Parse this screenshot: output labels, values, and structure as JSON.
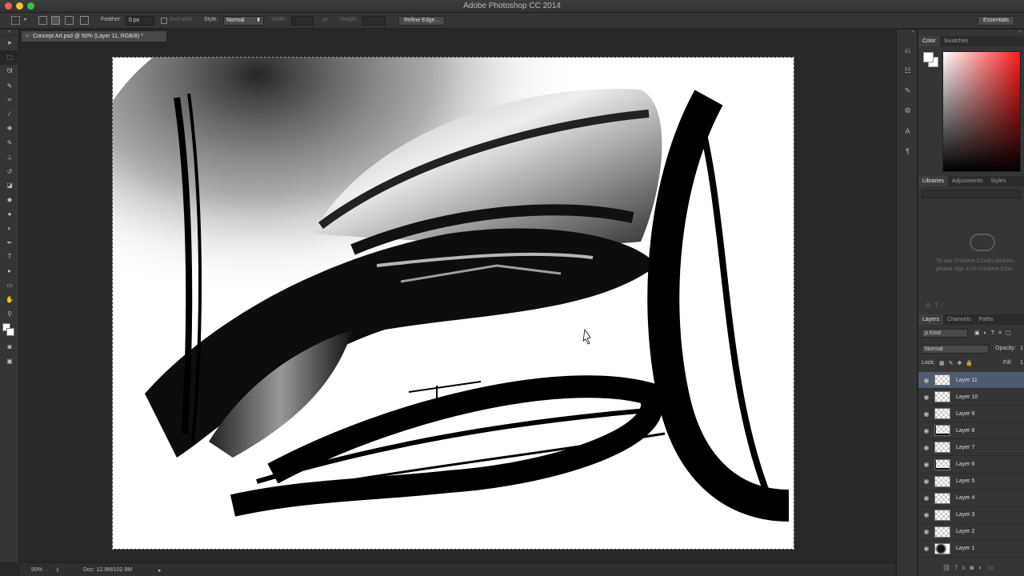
{
  "app": {
    "title": "Adobe Photoshop CC 2014"
  },
  "options_bar": {
    "feather_label": "Feather:",
    "feather_value": "0 px",
    "antialias_label": "Anti-alias",
    "style_label": "Style:",
    "style_value": "Normal",
    "width_label": "Width:",
    "height_label": "Height:",
    "refine_edge_label": "Refine Edge...",
    "workspace_label": "Essentials"
  },
  "document": {
    "tab_title": "Concept Art.psd @ 50% (Layer 11, RGB/8) *",
    "close_glyph": "×"
  },
  "status_bar": {
    "zoom": "50%",
    "doc_info": "Doc: 12.9M/102.9M"
  },
  "color_panel": {
    "tabs": [
      "Color",
      "Swatches"
    ],
    "foreground": "#ffffff",
    "background": "#ffffff",
    "hue_accent": "#ff1a1a"
  },
  "libraries_panel": {
    "tabs": [
      "Libraries",
      "Adjustments",
      "Styles"
    ],
    "message_line1": "To use Creative Cloud Libraries",
    "message_line2": "please sign in to Creative Clou"
  },
  "layers_panel": {
    "tabs": [
      "Layers",
      "Channels",
      "Paths"
    ],
    "kind_filter": "ρ Kind",
    "blend_mode": "Normal",
    "opacity_label": "Opacity:",
    "opacity_value": "1",
    "lock_label": "Lock:",
    "fill_label": "Fill:",
    "fill_value": "1",
    "selected_accent": "#4e5a72",
    "layers": [
      {
        "name": "Layer 11",
        "selected": true,
        "thumb": "transparent"
      },
      {
        "name": "Layer 10",
        "selected": false,
        "thumb": "transparent"
      },
      {
        "name": "Layer 9",
        "selected": false,
        "thumb": "transparent"
      },
      {
        "name": "Layer 8",
        "selected": false,
        "thumb": "strokes"
      },
      {
        "name": "Layer 7",
        "selected": false,
        "thumb": "transparent"
      },
      {
        "name": "Layer 6",
        "selected": false,
        "thumb": "strokes"
      },
      {
        "name": "Layer 5",
        "selected": false,
        "thumb": "transparent"
      },
      {
        "name": "Layer 4",
        "selected": false,
        "thumb": "transparent"
      },
      {
        "name": "Layer 3",
        "selected": false,
        "thumb": "transparent"
      },
      {
        "name": "Layer 2",
        "selected": false,
        "thumb": "transparent"
      },
      {
        "name": "Layer 1",
        "selected": false,
        "thumb": "sketch"
      }
    ]
  },
  "tools": [
    {
      "icon": "move-tool-icon",
      "glyph": "➤"
    },
    {
      "icon": "marquee-tool-icon",
      "glyph": "⬚"
    },
    {
      "icon": "lasso-tool-icon",
      "glyph": "ᘛ"
    },
    {
      "icon": "quick-selection-tool-icon",
      "glyph": "✎"
    },
    {
      "icon": "crop-tool-icon",
      "glyph": "⌗"
    },
    {
      "icon": "eyedropper-tool-icon",
      "glyph": "⁄"
    },
    {
      "icon": "healing-brush-tool-icon",
      "glyph": "✚"
    },
    {
      "icon": "brush-tool-icon",
      "glyph": "✎"
    },
    {
      "icon": "clone-stamp-tool-icon",
      "glyph": "⊥"
    },
    {
      "icon": "history-brush-tool-icon",
      "glyph": "↺"
    },
    {
      "icon": "eraser-tool-icon",
      "glyph": "◪"
    },
    {
      "icon": "paint-bucket-tool-icon",
      "glyph": "◆"
    },
    {
      "icon": "blur-tool-icon",
      "glyph": "●"
    },
    {
      "icon": "dodge-tool-icon",
      "glyph": "◐"
    },
    {
      "icon": "pen-tool-icon",
      "glyph": "✒"
    },
    {
      "icon": "type-tool-icon",
      "glyph": "T"
    },
    {
      "icon": "path-selection-tool-icon",
      "glyph": "▸"
    },
    {
      "icon": "rectangle-tool-icon",
      "glyph": "▭"
    },
    {
      "icon": "hand-tool-icon",
      "glyph": "✋"
    },
    {
      "icon": "zoom-tool-icon",
      "glyph": "⚲"
    }
  ],
  "strip_icons": [
    {
      "icon": "history-panel-icon",
      "glyph": "⎌"
    },
    {
      "icon": "properties-panel-icon",
      "glyph": "☷"
    },
    {
      "icon": "brush-presets-icon",
      "glyph": "✎"
    },
    {
      "icon": "tool-presets-icon",
      "glyph": "⚙"
    },
    {
      "icon": "character-panel-icon",
      "glyph": "A"
    },
    {
      "icon": "paragraph-panel-icon",
      "glyph": "¶"
    }
  ]
}
